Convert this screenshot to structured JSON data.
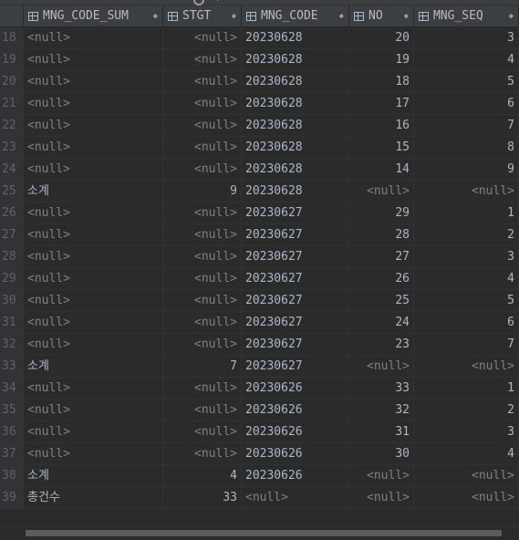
{
  "columns": [
    {
      "name": "MNG_CODE_SUM",
      "icon": "table-column-icon"
    },
    {
      "name": "STGT",
      "icon": "table-column-icon"
    },
    {
      "name": "MNG_CODE",
      "icon": "table-column-icon"
    },
    {
      "name": "NO",
      "icon": "table-column-icon"
    },
    {
      "name": "MNG_SEQ",
      "icon": "table-column-icon"
    }
  ],
  "sort_glyph": "◆",
  "rows": [
    {
      "n": "18",
      "mng_code_sum": "<null>",
      "stgt": "<null>",
      "mng_code": "20230628",
      "no": "20",
      "mng_seq": "3"
    },
    {
      "n": "19",
      "mng_code_sum": "<null>",
      "stgt": "<null>",
      "mng_code": "20230628",
      "no": "19",
      "mng_seq": "4"
    },
    {
      "n": "20",
      "mng_code_sum": "<null>",
      "stgt": "<null>",
      "mng_code": "20230628",
      "no": "18",
      "mng_seq": "5"
    },
    {
      "n": "21",
      "mng_code_sum": "<null>",
      "stgt": "<null>",
      "mng_code": "20230628",
      "no": "17",
      "mng_seq": "6"
    },
    {
      "n": "22",
      "mng_code_sum": "<null>",
      "stgt": "<null>",
      "mng_code": "20230628",
      "no": "16",
      "mng_seq": "7"
    },
    {
      "n": "23",
      "mng_code_sum": "<null>",
      "stgt": "<null>",
      "mng_code": "20230628",
      "no": "15",
      "mng_seq": "8"
    },
    {
      "n": "24",
      "mng_code_sum": "<null>",
      "stgt": "<null>",
      "mng_code": "20230628",
      "no": "14",
      "mng_seq": "9"
    },
    {
      "n": "25",
      "mng_code_sum": "소계",
      "stgt": "9",
      "mng_code": "20230628",
      "no": "<null>",
      "mng_seq": "<null>"
    },
    {
      "n": "26",
      "mng_code_sum": "<null>",
      "stgt": "<null>",
      "mng_code": "20230627",
      "no": "29",
      "mng_seq": "1"
    },
    {
      "n": "27",
      "mng_code_sum": "<null>",
      "stgt": "<null>",
      "mng_code": "20230627",
      "no": "28",
      "mng_seq": "2"
    },
    {
      "n": "28",
      "mng_code_sum": "<null>",
      "stgt": "<null>",
      "mng_code": "20230627",
      "no": "27",
      "mng_seq": "3"
    },
    {
      "n": "29",
      "mng_code_sum": "<null>",
      "stgt": "<null>",
      "mng_code": "20230627",
      "no": "26",
      "mng_seq": "4"
    },
    {
      "n": "30",
      "mng_code_sum": "<null>",
      "stgt": "<null>",
      "mng_code": "20230627",
      "no": "25",
      "mng_seq": "5"
    },
    {
      "n": "31",
      "mng_code_sum": "<null>",
      "stgt": "<null>",
      "mng_code": "20230627",
      "no": "24",
      "mng_seq": "6"
    },
    {
      "n": "32",
      "mng_code_sum": "<null>",
      "stgt": "<null>",
      "mng_code": "20230627",
      "no": "23",
      "mng_seq": "7"
    },
    {
      "n": "33",
      "mng_code_sum": "소계",
      "stgt": "7",
      "mng_code": "20230627",
      "no": "<null>",
      "mng_seq": "<null>"
    },
    {
      "n": "34",
      "mng_code_sum": "<null>",
      "stgt": "<null>",
      "mng_code": "20230626",
      "no": "33",
      "mng_seq": "1"
    },
    {
      "n": "35",
      "mng_code_sum": "<null>",
      "stgt": "<null>",
      "mng_code": "20230626",
      "no": "32",
      "mng_seq": "2"
    },
    {
      "n": "36",
      "mng_code_sum": "<null>",
      "stgt": "<null>",
      "mng_code": "20230626",
      "no": "31",
      "mng_seq": "3"
    },
    {
      "n": "37",
      "mng_code_sum": "<null>",
      "stgt": "<null>",
      "mng_code": "20230626",
      "no": "30",
      "mng_seq": "4"
    },
    {
      "n": "38",
      "mng_code_sum": "소계",
      "stgt": "4",
      "mng_code": "20230626",
      "no": "<null>",
      "mng_seq": "<null>"
    },
    {
      "n": "39",
      "mng_code_sum": "총건수",
      "stgt": "33",
      "mng_code": "<null>",
      "no": "<null>",
      "mng_seq": "<null>"
    }
  ],
  "colors": {
    "background": "#2b2b2b",
    "header": "#3c3f41",
    "text": "#a9b7c6",
    "null_text": "#808080",
    "row_number": "#606366"
  }
}
